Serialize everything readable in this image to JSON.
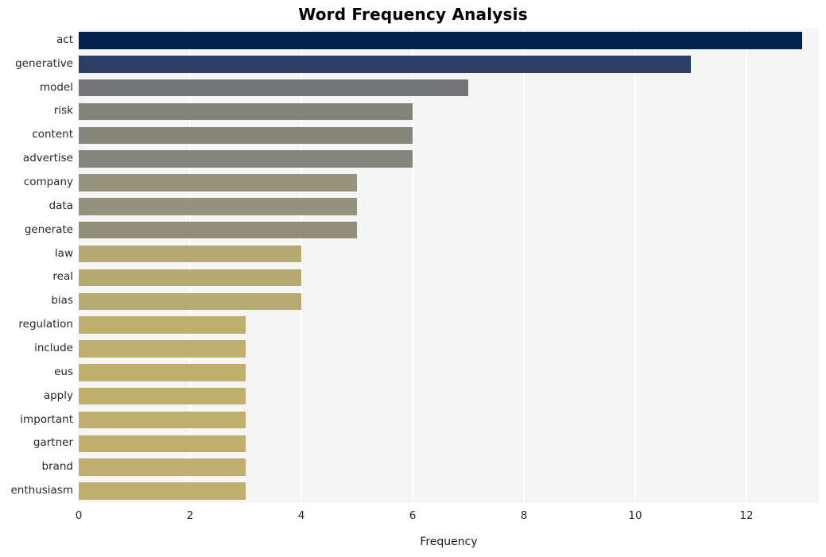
{
  "chart_data": {
    "type": "bar",
    "orientation": "horizontal",
    "title": "Word Frequency Analysis",
    "xlabel": "Frequency",
    "ylabel": "",
    "xlim": [
      0,
      13.3
    ],
    "xticks": [
      0,
      2,
      4,
      6,
      8,
      10,
      12
    ],
    "xtick_labels": [
      "0",
      "2",
      "4",
      "6",
      "8",
      "10",
      "12"
    ],
    "grid": "vertical-white-on-lightgray",
    "legend": "none",
    "categories": [
      "act",
      "generative",
      "model",
      "risk",
      "content",
      "advertise",
      "company",
      "data",
      "generate",
      "law",
      "real",
      "bias",
      "regulation",
      "include",
      "eus",
      "apply",
      "important",
      "gartner",
      "brand",
      "enthusiasm"
    ],
    "values": [
      13,
      11,
      7,
      6,
      6,
      6,
      5,
      5,
      5,
      4,
      4,
      4,
      3,
      3,
      3,
      3,
      3,
      3,
      3,
      3
    ],
    "bar_colors": [
      "#042250",
      "#2b3e68",
      "#747578",
      "#82827b",
      "#86857c",
      "#85847d",
      "#96937b",
      "#95927b",
      "#918e78",
      "#b5a871",
      "#b7a972",
      "#b7aa72",
      "#bfae6d",
      "#bfae6d",
      "#bfae6d",
      "#bfae6d",
      "#bfae6d",
      "#bfae6d",
      "#bfae6d",
      "#bfae6d"
    ],
    "plot_background": "#f5f5f5",
    "figure_background": "#ffffff",
    "gridline_color": "#ffffff"
  }
}
